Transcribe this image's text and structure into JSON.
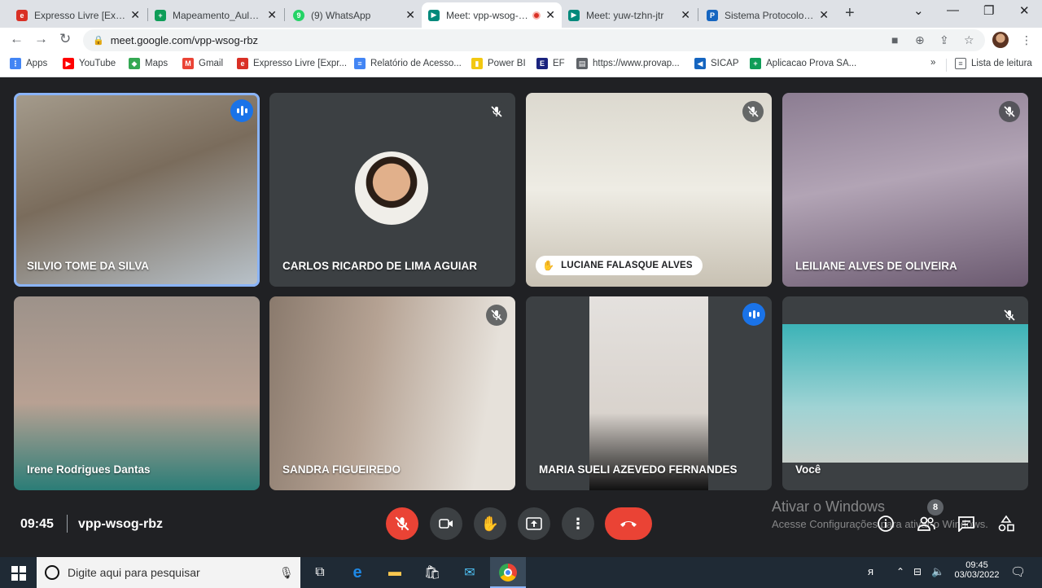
{
  "browser": {
    "tabs": [
      {
        "title": "Expresso Livre [Expresso Livre]",
        "fav_color": "#d93025",
        "active": false
      },
      {
        "title": "Mapeamento_Aulas conf.",
        "fav_color": "#0f9d58",
        "active": false
      },
      {
        "title": "(9) WhatsApp",
        "fav_color": "#25d366",
        "active": false
      },
      {
        "title": "Meet: vpp-wsog-rbz",
        "fav_color": "#00897b",
        "active": true
      },
      {
        "title": "Meet: yuw-tzhn-jtr",
        "fav_color": "#00897b",
        "active": false
      },
      {
        "title": "Sistema Protocolo Integrado",
        "fav_color": "#1565c0",
        "active": false
      }
    ],
    "url": "meet.google.com/vpp-wsog-rbz",
    "bookmarks": [
      {
        "label": "Apps",
        "color": "#4285f4"
      },
      {
        "label": "YouTube",
        "color": "#ff0000"
      },
      {
        "label": "Maps",
        "color": "#34a853"
      },
      {
        "label": "Gmail",
        "color": "#ea4335"
      },
      {
        "label": "Expresso Livre [Expr...",
        "color": "#d93025"
      },
      {
        "label": "Relatório de Acesso...",
        "color": "#4285f4"
      },
      {
        "label": "Power BI",
        "color": "#f2c811"
      },
      {
        "label": "EF",
        "color": "#1a237e"
      },
      {
        "label": "https://www.provap...",
        "color": "#5f6368"
      },
      {
        "label": "SICAP",
        "color": "#1565c0"
      },
      {
        "label": "Aplicacao Prova SA...",
        "color": "#0f9d58"
      }
    ],
    "reading_list": "Lista de leitura"
  },
  "meet": {
    "participants": [
      {
        "name": "SILVIO TOME DA SILVA",
        "state": "talking",
        "bg": "linear-gradient(160deg,#a59c8d 0%,#7a6c5c 45%,#b9c3cb 100%)"
      },
      {
        "name": "CARLOS RICARDO DE LIMA AGUIAR",
        "state": "muted",
        "bg": "#3c4043"
      },
      {
        "name": "LUCIANE FALASQUE ALVES",
        "state": "muted",
        "bg": "linear-gradient(180deg,#dcd9cf 0%,#eeece4 50%,#c8c1b3 100%)"
      },
      {
        "name": "LEILIANE ALVES DE OLIVEIRA",
        "state": "muted",
        "bg": "linear-gradient(170deg,#8c7d92 0%,#b2a4b5 45%,#6b5a70 100%)"
      },
      {
        "name": "Irene Rodrigues Dantas",
        "state": "none",
        "bg": "linear-gradient(180deg,#9d928a 0%,#b8a193 55%,#2b7d77 100%)"
      },
      {
        "name": "SANDRA FIGUEIREDO",
        "state": "muted",
        "bg": "linear-gradient(100deg,#8a7a6d 0%,#b5a293 40%,#e6e1da 85%)"
      },
      {
        "name": "MARIA SUELI AZEVEDO FERNANDES",
        "state": "talking",
        "bg": "linear-gradient(180deg,#e4e1de 0%,#d9d3cd 60%,#111 100%)"
      },
      {
        "name": "Você",
        "state": "muted",
        "bg": "linear-gradient(180deg,#3cb3b7 0%,#9fd3d4 60%,#c7cfca 100%)"
      }
    ],
    "clock": "09:45",
    "meeting_code": "vpp-wsog-rbz",
    "people_count": "8",
    "activate_title": "Ativar o Windows",
    "activate_sub": "Acesse Configurações para ativar o Windows."
  },
  "taskbar": {
    "search_placeholder": "Digite aqui para pesquisar",
    "time": "09:45",
    "date": "03/03/2022"
  }
}
